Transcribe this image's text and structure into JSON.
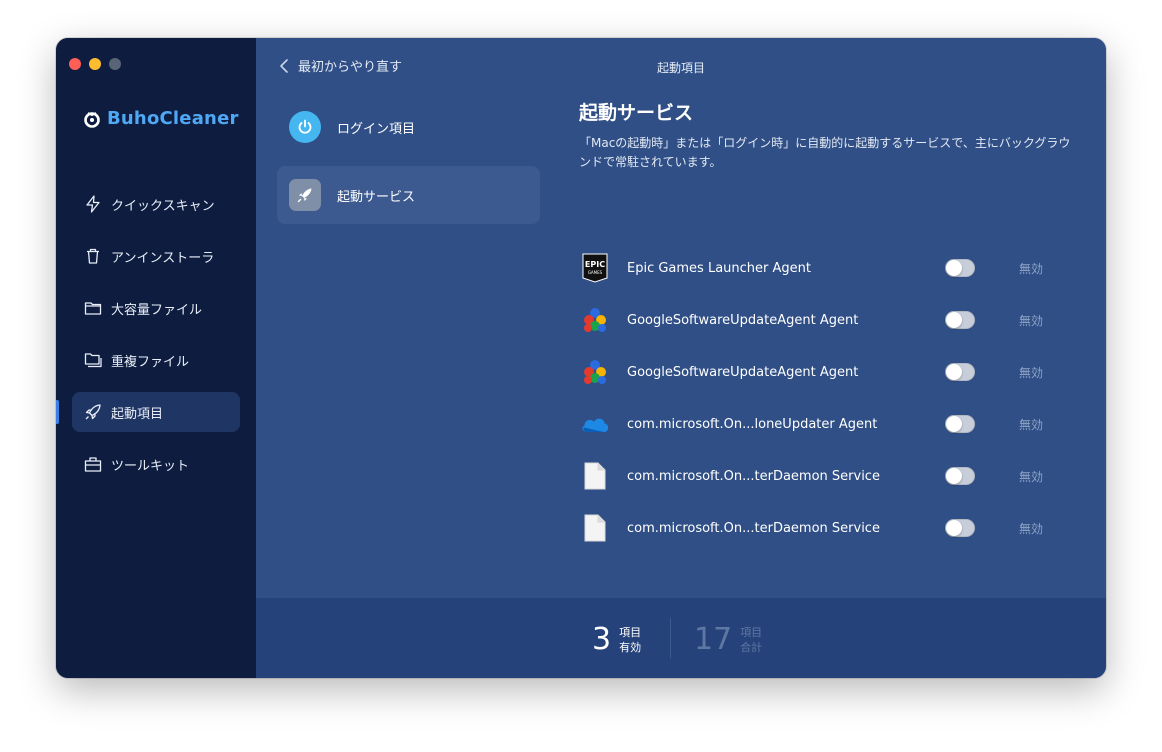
{
  "app": {
    "name": "BuhoCleaner",
    "window_title": "起動項目"
  },
  "colors": {
    "sidebar_bg": "#0e1d3f",
    "main_bg": "#2f4f86",
    "accent": "#4fa8f5",
    "footer_bg": "#26427a"
  },
  "traffic_lights": [
    {
      "name": "close",
      "color": "#ff5f57"
    },
    {
      "name": "minimize",
      "color": "#febc2e"
    },
    {
      "name": "zoom",
      "color": "#5a6478"
    }
  ],
  "sidebar": {
    "items": [
      {
        "label": "クイックスキャン",
        "icon": "bolt-icon",
        "active": false
      },
      {
        "label": "アンインストーラ",
        "icon": "trash-icon",
        "active": false
      },
      {
        "label": "大容量ファイル",
        "icon": "folder-icon",
        "active": false
      },
      {
        "label": "重複ファイル",
        "icon": "duplicate-folder-icon",
        "active": false
      },
      {
        "label": "起動項目",
        "icon": "rocket-icon",
        "active": true
      },
      {
        "label": "ツールキット",
        "icon": "toolkit-icon",
        "active": false
      }
    ]
  },
  "topbar": {
    "back_label": "最初からやり直す"
  },
  "submenu": {
    "items": [
      {
        "label": "ログイン項目",
        "icon": "power-icon",
        "active": false
      },
      {
        "label": "起動サービス",
        "icon": "rocket-icon",
        "active": true
      }
    ]
  },
  "section": {
    "title": "起動サービス",
    "description": "「Macの起動時」または「ログイン時」に自動的に起動するサービスで、主にバックグラウンドで常駐されています。"
  },
  "services": [
    {
      "name": "Epic Games Launcher Agent",
      "icon": "epic-games-icon",
      "status": "無効",
      "enabled": false
    },
    {
      "name": "GoogleSoftwareUpdateAgent Agent",
      "icon": "google-update-icon",
      "status": "無効",
      "enabled": false
    },
    {
      "name": "GoogleSoftwareUpdateAgent Agent",
      "icon": "google-update-icon",
      "status": "無効",
      "enabled": false
    },
    {
      "name": "com.microsoft.On...loneUpdater Agent",
      "icon": "onedrive-icon",
      "status": "無効",
      "enabled": false
    },
    {
      "name": "com.microsoft.On...terDaemon Service",
      "icon": "file-icon",
      "status": "無効",
      "enabled": false
    },
    {
      "name": "com.microsoft.On...terDaemon Service",
      "icon": "file-icon",
      "status": "無効",
      "enabled": false
    }
  ],
  "footer": {
    "enabled_count": "3",
    "enabled_label_1": "項目",
    "enabled_label_2": "有効",
    "total_count": "17",
    "total_label_1": "項目",
    "total_label_2": "合計"
  }
}
